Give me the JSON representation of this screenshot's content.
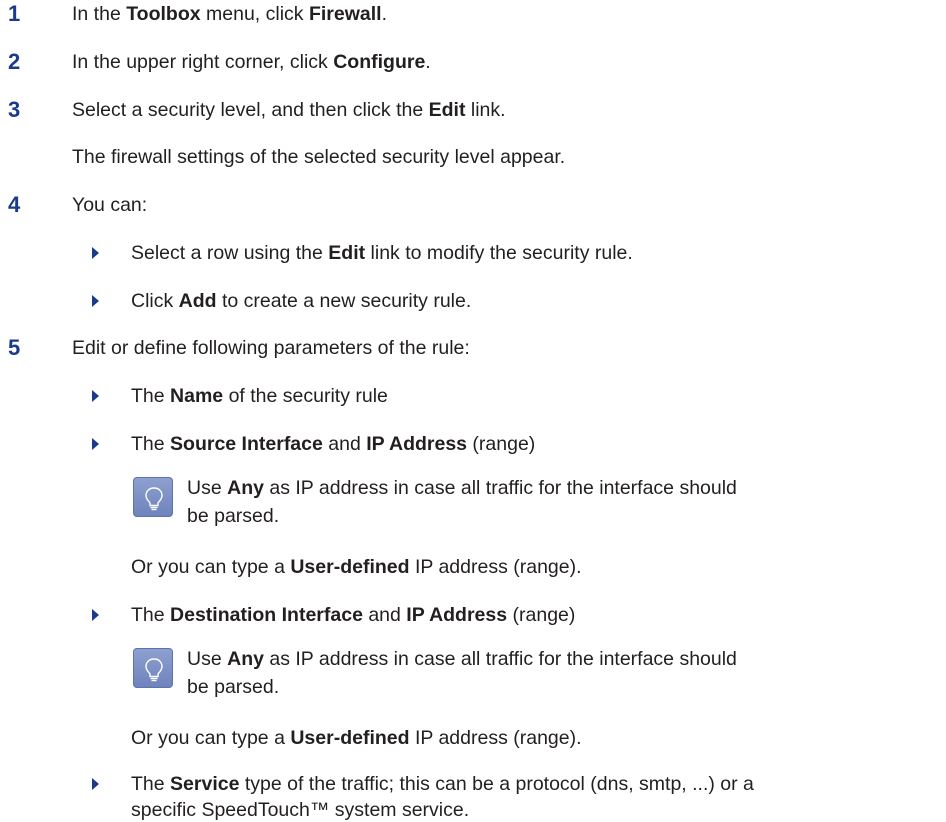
{
  "steps": [
    {
      "num": "1",
      "pre": "In the ",
      "b1": "Toolbox",
      "mid": " menu, click ",
      "b2": "Firewall",
      "post": "."
    },
    {
      "num": "2",
      "pre": "In the upper right corner, click ",
      "b1": "Configure",
      "post": "."
    },
    {
      "num": "3",
      "pre": "Select a security level, and then click the ",
      "b1": "Edit",
      "post": " link.",
      "note": "The firewall settings of the selected security level appear."
    },
    {
      "num": "4",
      "text": "You can:"
    },
    {
      "num": "5",
      "text": "Edit or define following parameters of the rule:"
    }
  ],
  "step4_bullets": [
    {
      "pre": "Select a row using the ",
      "b1": "Edit",
      "post": " link to modify the security rule."
    },
    {
      "pre": "Click ",
      "b1": "Add",
      "post": " to create a new security rule."
    }
  ],
  "step5_bullets": [
    {
      "pre": "The ",
      "b1": "Name",
      "post": " of the security rule"
    },
    {
      "pre": "The ",
      "b1": "Source Interface",
      "mid": " and ",
      "b2": "IP Address",
      "post": " (range)"
    },
    {
      "pre": "The ",
      "b1": "Destination Interface",
      "mid": " and ",
      "b2": "IP Address",
      "post": " (range)"
    },
    {
      "pre": "The ",
      "b1": "Service",
      "post": " type of the traffic; this can be a protocol (dns, smtp, ...) or a",
      "line2": "specific SpeedTouch™ system service."
    }
  ],
  "tip": {
    "pre": "Use ",
    "b1": "Any",
    "post": " as IP address in case all traffic for the interface should",
    "line2": "be parsed.",
    "or_pre": "Or you can type a ",
    "or_b": "User-defined",
    "or_post": " IP address (range)."
  },
  "icons": {
    "tip": "lightbulb-icon",
    "bullet": "triangle-bullet-icon"
  },
  "colors": {
    "step_number": "#1b3a8c",
    "tip_icon_bg": "#7d90c6",
    "text": "#231f20"
  }
}
